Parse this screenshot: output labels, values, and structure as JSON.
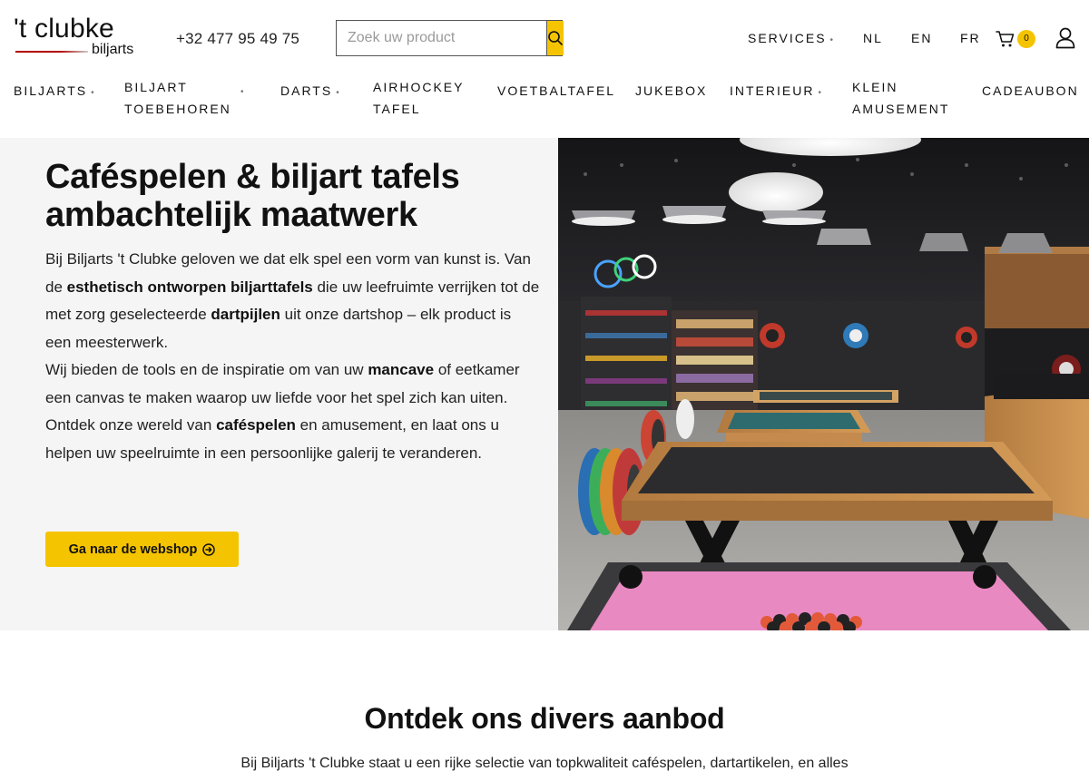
{
  "header": {
    "logo_main": "'t clubke",
    "logo_sub": "biljarts",
    "phone": "+32 477 95 49 75",
    "search_placeholder": "Zoek uw product",
    "services": "SERVICES",
    "languages": [
      "NL",
      "EN",
      "FR"
    ],
    "cart_count": "0"
  },
  "nav": {
    "biljarts": "BILJARTS",
    "toebehoren_1": "BILJART",
    "toebehoren_2": "TOEBEHOREN",
    "darts": "DARTS",
    "airhockey_1": "AIRHOCKEY",
    "airhockey_2": "TAFEL",
    "voetbaltafel": "VOETBALTAFEL",
    "jukebox": "JUKEBOX",
    "interieur": "INTERIEUR",
    "klein_1": "KLEIN",
    "klein_2": "AMUSEMENT",
    "cadeaubon": "CADEAUBON"
  },
  "hero": {
    "title_line1": "Caféspelen & biljart tafels",
    "title_line2": "ambachtelijk maatwerk",
    "p1_a": "Bij Biljarts 't Clubke geloven we dat elk spel een vorm van kunst is. Van de ",
    "p1_b": "esthetisch ontworpen biljarttafels",
    "p1_c": " die uw leefruimte verrijken tot de met zorg geselecteerde ",
    "p1_d": "dartpijlen",
    "p1_e": " uit onze dartshop – elk product is een meesterwerk.",
    "p2_a": "Wij bieden de tools en de inspiratie om van uw ",
    "p2_b": "mancave",
    "p2_c": " of eetkamer een canvas te maken waarop uw liefde voor het spel zich kan uiten. Ontdek onze wereld van ",
    "p2_d": "caféspelen",
    "p2_e": " en amusement, en laat ons u helpen uw speelruimte in een persoonlijke galerij te veranderen.",
    "cta": "Ga naar de webshop"
  },
  "section": {
    "title": "Ontdek ons divers aanbod",
    "text": "Bij Biljarts 't Clubke staat u een rijke selectie van topkwaliteit caféspelen, dartartikelen, en alles"
  },
  "colors": {
    "accent": "#f5c400",
    "hero_bg": "#f5f5f5",
    "text": "#111111"
  }
}
